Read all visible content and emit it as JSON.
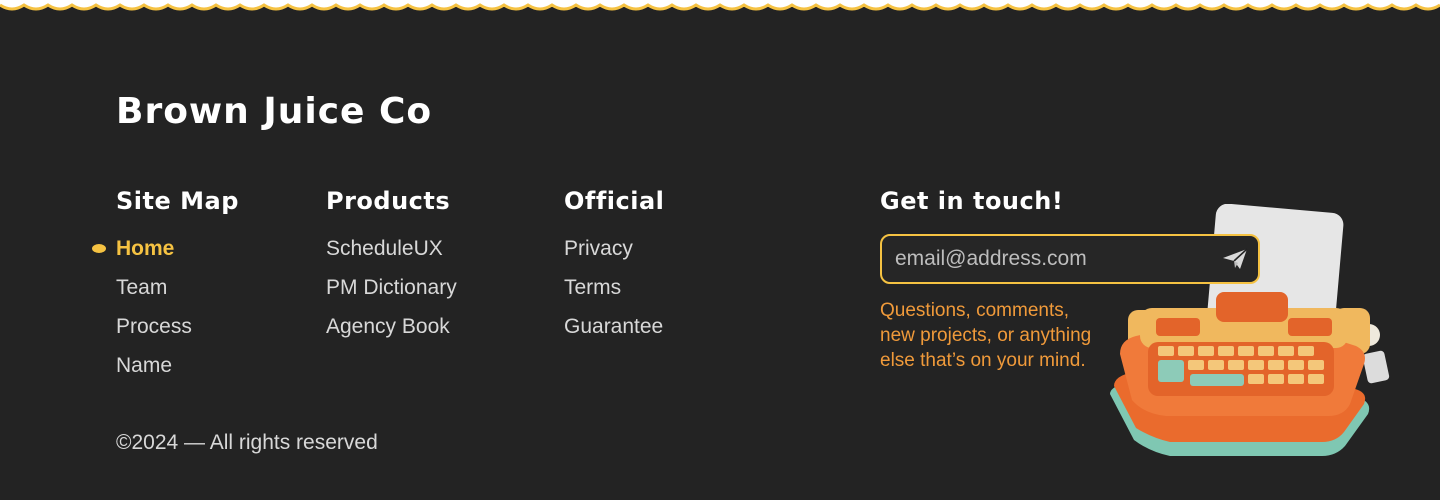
{
  "brand": {
    "name": "Brown Juice Co"
  },
  "columns": [
    {
      "title": "Site Map",
      "items": [
        "Home",
        "Team",
        "Process",
        "Name"
      ],
      "active": "Home"
    },
    {
      "title": "Products",
      "items": [
        "ScheduleUX",
        "PM Dictionary",
        "Agency Book"
      ]
    },
    {
      "title": "Official",
      "items": [
        "Privacy",
        "Terms",
        "Guarantee"
      ]
    }
  ],
  "contact": {
    "title": "Get in touch!",
    "email_placeholder": "email@address.com",
    "email_value": "",
    "note": "Questions, comments, new projects, or anything else that’s on your mind.",
    "send_icon": "paper-plane-icon",
    "illustration": "typewriter-illustration"
  },
  "copyright": "©2024 — All rights reserved",
  "colors": {
    "background": "#232323",
    "accent": "#f5c242",
    "note": "#f09a3a",
    "text": "#d8d8d8",
    "heading": "#ffffff"
  }
}
